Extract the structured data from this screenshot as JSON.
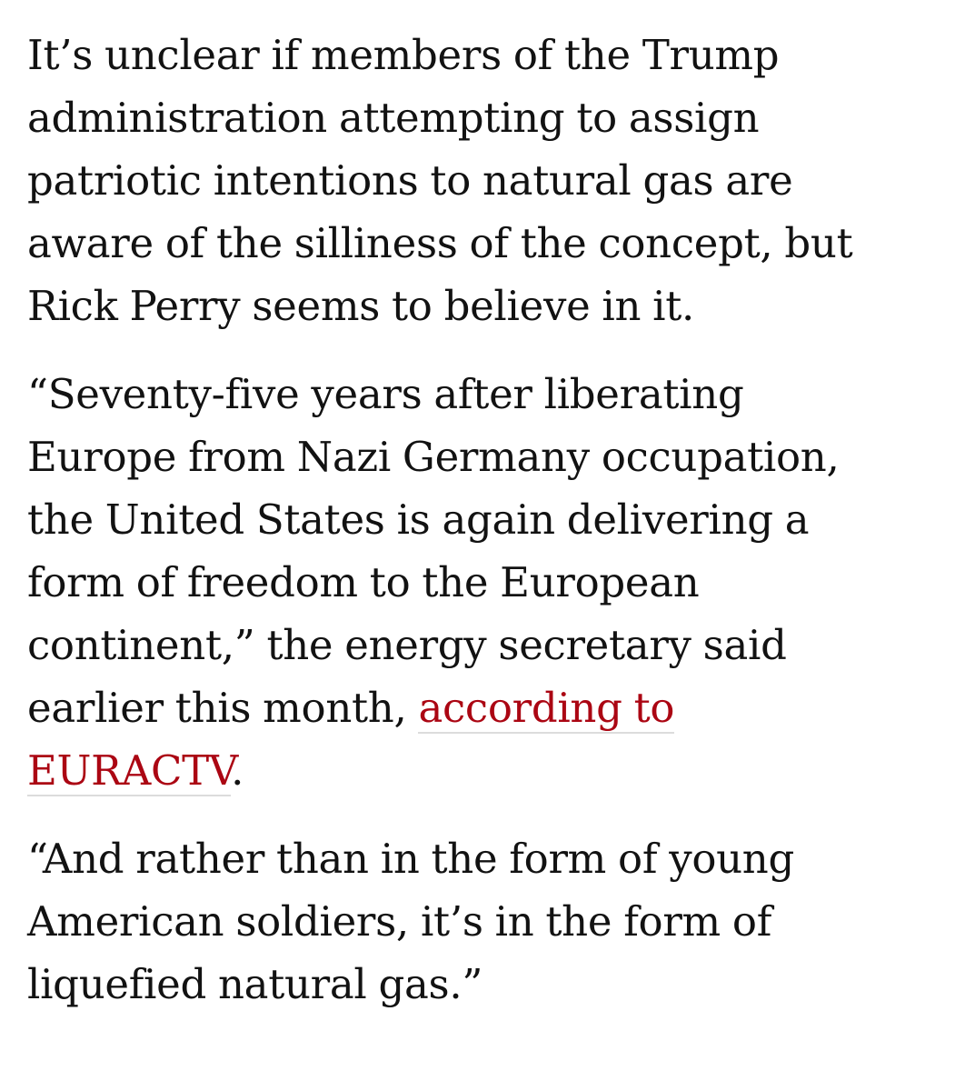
{
  "article": {
    "paragraphs": [
      {
        "lines": [
          "It’s unclear if members of the Trump",
          "administration attempting to assign",
          "patriotic intentions to natural gas are",
          "aware of the silliness of the concept, but",
          "Rick Perry seems to believe in it."
        ]
      },
      {
        "lines": [
          "“Seventy-five years after liberating",
          "Europe from Nazi Germany occupation,",
          "the United States is again delivering a",
          "form of freedom to the European",
          "continent,” the energy secretary said",
          "earlier this month, "
        ],
        "link_text_1": "according to",
        "link_text_2": "EURACTV",
        "after_link": "."
      },
      {
        "lines": [
          "“And rather than in the form of young",
          "American soldiers, it’s in the form of",
          "liquefied natural gas.”"
        ]
      }
    ]
  },
  "colors": {
    "text": "#121212",
    "link": "#ab0613",
    "link_underline": "#dcdcdc",
    "background": "#ffffff"
  }
}
